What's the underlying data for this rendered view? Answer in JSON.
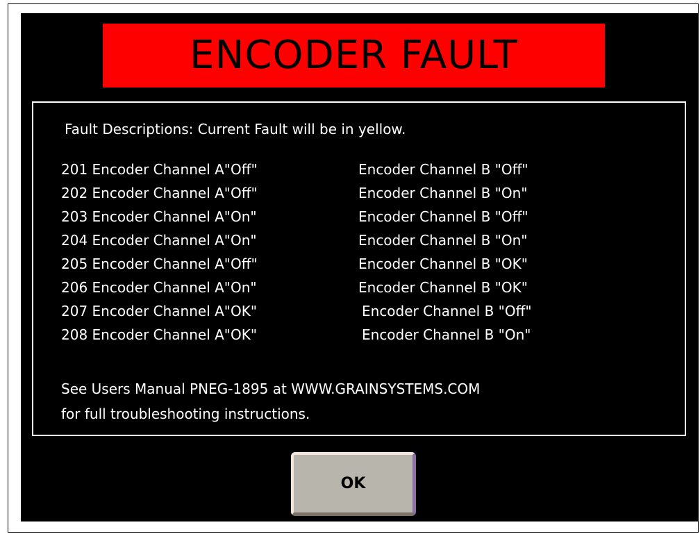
{
  "title": "ENCODER FAULT",
  "description_header": "Fault Descriptions:  Current Fault will be in yellow.",
  "faults": [
    {
      "channel_a": "201 Encoder Channel A\"Off\"",
      "channel_b": "Encoder Channel B \"Off\""
    },
    {
      "channel_a": "202 Encoder Channel A\"Off\"",
      "channel_b": "Encoder Channel B \"On\""
    },
    {
      "channel_a": "203 Encoder Channel A\"On\"",
      "channel_b": "Encoder Channel B \"Off\""
    },
    {
      "channel_a": "204 Encoder Channel A\"On\"",
      "channel_b": "Encoder Channel B \"On\""
    },
    {
      "channel_a": "205 Encoder Channel A\"Off\"",
      "channel_b": "Encoder Channel B \"OK\""
    },
    {
      "channel_a": "206 Encoder Channel A\"On\"",
      "channel_b": "Encoder Channel B \"OK\""
    },
    {
      "channel_a": "207 Encoder Channel A\"OK\"",
      "channel_b": "Encoder Channel B \"Off\""
    },
    {
      "channel_a": "208 Encoder Channel A\"OK\"",
      "channel_b": "Encoder Channel B \"On\""
    }
  ],
  "footer": {
    "line1": "See Users Manual PNEG-1895 at WWW.GRAINSYSTEMS.COM",
    "line2": "for full troubleshooting instructions."
  },
  "ok_button": {
    "label": "OK"
  },
  "colors": {
    "background": "#000000",
    "title_banner": "#ff0000",
    "title_text": "#000000",
    "body_text": "#ffffff",
    "current_fault": "#ffff00",
    "button_face": "#b8b5ad"
  }
}
